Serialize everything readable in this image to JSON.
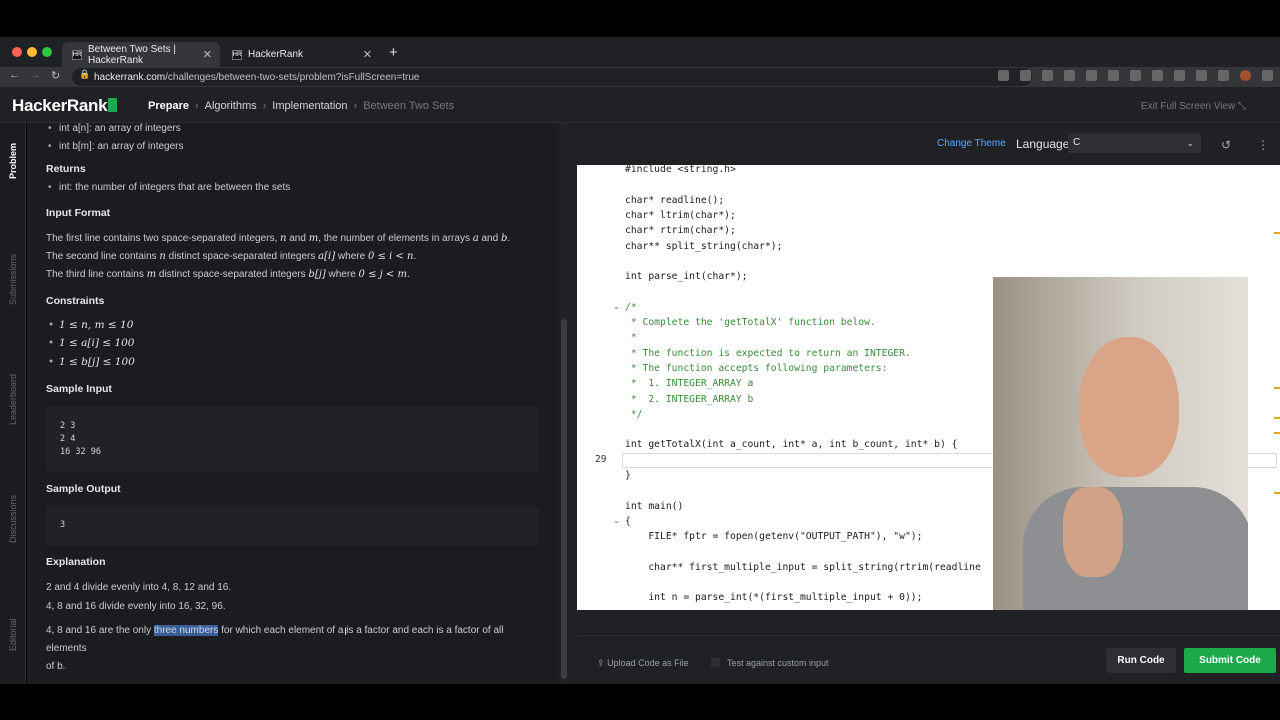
{
  "browser": {
    "tabs": [
      {
        "favicon": "HR",
        "title": "Between Two Sets | HackerRank"
      },
      {
        "favicon": "HR",
        "title": "HackerRank"
      }
    ],
    "url_host": "hackerrank.com",
    "url_path": "/challenges/between-two-sets/problem?isFullScreen=true"
  },
  "header": {
    "logo": "HackerRank",
    "breadcrumbs": [
      "Prepare",
      "Algorithms",
      "Implementation",
      "Between Two Sets"
    ],
    "exit_fullscreen": "Exit Full Screen View"
  },
  "sidebar_tabs": [
    "Problem",
    "Submissions",
    "Leaderboard",
    "Discussions",
    "Editorial"
  ],
  "problem": {
    "param_a": "int a[n]: an array of integers",
    "param_b": "int b[m]: an array of integers",
    "returns_title": "Returns",
    "returns_text": "int: the number of integers that are between the sets",
    "input_format_title": "Input Format",
    "input_line1_pre": "The first line contains two space-separated integers,",
    "input_line1_n": "n",
    "input_line1_and": "and",
    "input_line1_m": "m",
    "input_line1_post": ", the number of elements in arrays",
    "input_line1_a": "a",
    "input_line1_and2": "and",
    "input_line1_b": "b",
    "input_line2_pre": "The second line contains",
    "input_line2_n": "n",
    "input_line2_mid": "distinct space-separated integers",
    "input_line2_ai": "a[i]",
    "input_line2_where": "where",
    "input_line2_cond": "0 ≤ i < n",
    "input_line3_pre": "The third line contains",
    "input_line3_m": "m",
    "input_line3_mid": "distinct space-separated integers",
    "input_line3_bj": "b[j]",
    "input_line3_where": "where",
    "input_line3_cond": "0 ≤ j < m",
    "constraints_title": "Constraints",
    "constraints": [
      "1 ≤ n, m ≤ 10",
      "1 ≤ a[i] ≤ 100",
      "1 ≤ b[j] ≤ 100"
    ],
    "sample_input_title": "Sample Input",
    "sample_input": [
      "2 3",
      "2 4",
      "16 32 96"
    ],
    "sample_output_title": "Sample Output",
    "sample_output": "3",
    "explanation_title": "Explanation",
    "explanation1": "2 and 4 divide evenly into 4, 8, 12 and 16.",
    "explanation2": "4, 8 and 16 divide evenly into 16, 32, 96.",
    "explanation3_pre": "4, 8 and 16 are the only ",
    "explanation3_hl": "three numbers",
    "explanation3_post": " for which each element of a is a factor and each is a factor of all elements",
    "explanation3_end": "of b."
  },
  "editor": {
    "change_theme": "Change Theme",
    "language_label": "Language",
    "language_value": "C",
    "current_line_number": "29",
    "lines": [
      {
        "t": "#include <string.h>",
        "c": false,
        "indent": 0
      },
      {
        "t": "",
        "c": false,
        "indent": 0
      },
      {
        "t": "char* readline();",
        "c": false,
        "indent": 0
      },
      {
        "t": "char* ltrim(char*);",
        "c": false,
        "indent": 0
      },
      {
        "t": "char* rtrim(char*);",
        "c": false,
        "indent": 0
      },
      {
        "t": "char** split_string(char*);",
        "c": false,
        "indent": 0
      },
      {
        "t": "",
        "c": false,
        "indent": 0
      },
      {
        "t": "int parse_int(char*);",
        "c": false,
        "indent": 0
      },
      {
        "t": "",
        "c": false,
        "indent": 0
      },
      {
        "t": "/*",
        "c": true,
        "indent": 0
      },
      {
        "t": " * Complete the 'getTotalX' function below.",
        "c": true,
        "indent": 0
      },
      {
        "t": " *",
        "c": true,
        "indent": 0
      },
      {
        "t": " * The function is expected to return an INTEGER.",
        "c": true,
        "indent": 0
      },
      {
        "t": " * The function accepts following parameters:",
        "c": true,
        "indent": 0
      },
      {
        "t": " *  1. INTEGER_ARRAY a",
        "c": true,
        "indent": 0
      },
      {
        "t": " *  2. INTEGER_ARRAY b",
        "c": true,
        "indent": 0
      },
      {
        "t": " */",
        "c": true,
        "indent": 0
      },
      {
        "t": "",
        "c": false,
        "indent": 0
      },
      {
        "t": "int getTotalX(int a_count, int* a, int b_count, int* b) {",
        "c": false,
        "indent": 0
      },
      {
        "t": "",
        "c": false,
        "indent": 0
      },
      {
        "t": "}",
        "c": false,
        "indent": 0
      },
      {
        "t": "",
        "c": false,
        "indent": 0
      },
      {
        "t": "int main()",
        "c": false,
        "indent": 0
      },
      {
        "t": "{",
        "c": false,
        "indent": 0
      },
      {
        "t": "    FILE* fptr = fopen(getenv(\"OUTPUT_PATH\"), \"w\");",
        "c": false,
        "indent": 0
      },
      {
        "t": "",
        "c": false,
        "indent": 0
      },
      {
        "t": "    char** first_multiple_input = split_string(rtrim(readline",
        "c": false,
        "indent": 0
      },
      {
        "t": "",
        "c": false,
        "indent": 0
      },
      {
        "t": "    int n = parse_int(*(first_multiple_input + 0));",
        "c": false,
        "indent": 0
      }
    ]
  },
  "footer": {
    "upload": "Upload Code as File",
    "custom_input": "Test against custom input",
    "run": "Run Code",
    "submit": "Submit Code"
  },
  "colors": {
    "brand_green": "#1ba94c",
    "link_blue": "#5aa8ff",
    "comment_green": "#3a8b3a"
  }
}
